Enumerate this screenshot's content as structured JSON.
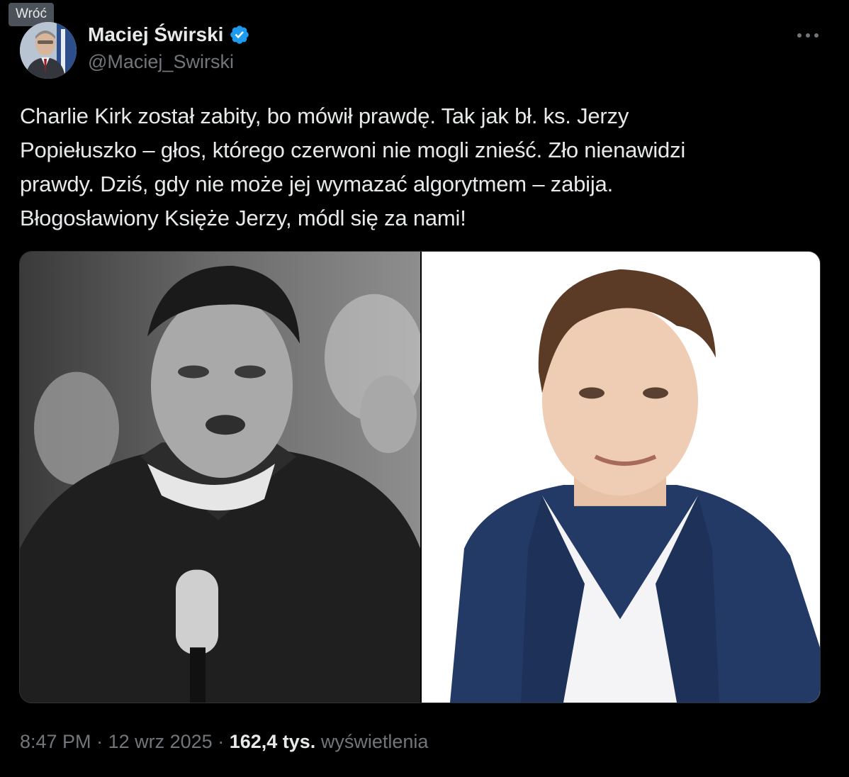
{
  "tooltip": {
    "back_label": "Wróć"
  },
  "author": {
    "display_name": "Maciej Świrski",
    "handle": "@Maciej_Swirski",
    "verified": true
  },
  "menu": {
    "more_icon": "more-horizontal-icon"
  },
  "tweet": {
    "text_lines": [
      "Charlie Kirk został zabity, bo mówił prawdę. Tak jak bł. ks. Jerzy",
      "Popiełuszko – głos, którego czerwoni nie mogli znieść. Zło nienawidzi",
      "prawdy. Dziś, gdy nie może jej wymazać algorytmem – zabija.",
      "Błogosławiony Księże Jerzy, módl się za nami!"
    ]
  },
  "media": {
    "left_image": "black-and-white photo of a priest speaking into a microphone",
    "right_image": "color portrait of a young man in a blue blazer"
  },
  "meta": {
    "time": "8:47 PM",
    "separator": "·",
    "date": "12 wrz 2025",
    "views_count": "162,4 tys.",
    "views_label": "wyświetlenia"
  },
  "colors": {
    "background": "#000000",
    "text_primary": "#e7e9ea",
    "text_secondary": "#71767b",
    "verified_badge": "#1d9bf0"
  }
}
